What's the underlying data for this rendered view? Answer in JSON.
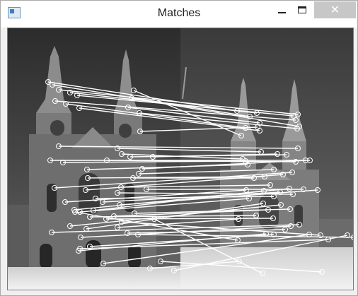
{
  "window": {
    "title": "Matches",
    "icons": {
      "app": "app-window-icon",
      "minimize": "minimize-icon",
      "maximize": "maximize-icon",
      "close": "close-icon"
    },
    "close_glyph": "✕"
  },
  "image": {
    "content": "feature-matches-visualization",
    "colors": {
      "match_line": "#ffffff",
      "keypoint": "#ffffff"
    }
  },
  "matches": [
    [
      [
        57,
        76
      ],
      [
        324,
        117
      ]
    ],
    [
      [
        63,
        80
      ],
      [
        342,
        125
      ]
    ],
    [
      [
        72,
        87
      ],
      [
        410,
        122
      ]
    ],
    [
      [
        88,
        91
      ],
      [
        352,
        120
      ]
    ],
    [
      [
        98,
        95
      ],
      [
        404,
        124
      ]
    ],
    [
      [
        67,
        103
      ],
      [
        407,
        130
      ]
    ],
    [
      [
        82,
        107
      ],
      [
        336,
        141
      ]
    ],
    [
      [
        101,
        113
      ],
      [
        356,
        145
      ]
    ],
    [
      [
        178,
        88
      ],
      [
        330,
        152
      ]
    ],
    [
      [
        175,
        99
      ],
      [
        412,
        139
      ]
    ],
    [
      [
        170,
        112
      ],
      [
        356,
        134
      ]
    ],
    [
      [
        186,
        120
      ],
      [
        409,
        142
      ]
    ],
    [
      [
        187,
        146
      ],
      [
        353,
        140
      ]
    ],
    [
      [
        72,
        167
      ],
      [
        410,
        170
      ]
    ],
    [
      [
        155,
        170
      ],
      [
        358,
        175
      ]
    ],
    [
      [
        161,
        178
      ],
      [
        332,
        185
      ]
    ],
    [
      [
        173,
        182
      ],
      [
        394,
        179
      ]
    ],
    [
      [
        205,
        182
      ],
      [
        381,
        178
      ]
    ],
    [
      [
        60,
        187
      ],
      [
        427,
        187
      ]
    ],
    [
      [
        78,
        190
      ],
      [
        336,
        188
      ]
    ],
    [
      [
        112,
        200
      ],
      [
        339,
        193
      ]
    ],
    [
      [
        140,
        187
      ],
      [
        407,
        189
      ]
    ],
    [
      [
        190,
        199
      ],
      [
        421,
        187
      ]
    ],
    [
      [
        185,
        206
      ],
      [
        376,
        200
      ]
    ],
    [
      [
        113,
        212
      ],
      [
        363,
        210
      ]
    ],
    [
      [
        177,
        212
      ],
      [
        348,
        212
      ]
    ],
    [
      [
        66,
        226
      ],
      [
        402,
        204
      ]
    ],
    [
      [
        110,
        229
      ],
      [
        389,
        207
      ]
    ],
    [
      [
        160,
        225
      ],
      [
        371,
        222
      ]
    ],
    [
      [
        196,
        228
      ],
      [
        418,
        228
      ]
    ],
    [
      [
        81,
        246
      ],
      [
        337,
        229
      ]
    ],
    [
      [
        94,
        257
      ],
      [
        398,
        227
      ]
    ],
    [
      [
        124,
        241
      ],
      [
        376,
        238
      ]
    ],
    [
      [
        155,
        233
      ],
      [
        403,
        235
      ]
    ],
    [
      [
        134,
        246
      ],
      [
        385,
        232
      ]
    ],
    [
      [
        121,
        258
      ],
      [
        362,
        230
      ]
    ],
    [
      [
        158,
        250
      ],
      [
        438,
        229
      ]
    ],
    [
      [
        102,
        260
      ],
      [
        341,
        241
      ]
    ],
    [
      [
        150,
        266
      ],
      [
        368,
        257
      ]
    ],
    [
      [
        179,
        262
      ],
      [
        399,
        256
      ]
    ],
    [
      [
        116,
        267
      ],
      [
        351,
        265
      ]
    ],
    [
      [
        62,
        289
      ],
      [
        412,
        278
      ]
    ],
    [
      [
        139,
        270
      ],
      [
        375,
        269
      ]
    ],
    [
      [
        88,
        280
      ],
      [
        386,
        250
      ]
    ],
    [
      [
        111,
        284
      ],
      [
        361,
        248
      ]
    ],
    [
      [
        155,
        282
      ],
      [
        326,
        270
      ]
    ],
    [
      [
        161,
        274
      ],
      [
        442,
        293
      ]
    ],
    [
      [
        116,
        309
      ],
      [
        376,
        292
      ]
    ],
    [
      [
        103,
        296
      ],
      [
        400,
        280
      ]
    ],
    [
      [
        102,
        312
      ],
      [
        453,
        299
      ]
    ],
    [
      [
        169,
        290
      ],
      [
        392,
        285
      ]
    ],
    [
      [
        135,
        333
      ],
      [
        426,
        292
      ]
    ],
    [
      [
        100,
        315
      ],
      [
        365,
        291
      ]
    ],
    [
      [
        201,
        340
      ],
      [
        327,
        330
      ]
    ],
    [
      [
        216,
        330
      ],
      [
        444,
        345
      ]
    ],
    [
      [
        235,
        343
      ],
      [
        480,
        293
      ]
    ],
    [
      [
        207,
        270
      ],
      [
        360,
        347
      ]
    ],
    [
      [
        184,
        292
      ],
      [
        489,
        296
      ]
    ],
    [
      [
        95,
        260
      ],
      [
        325,
        300
      ]
    ]
  ]
}
